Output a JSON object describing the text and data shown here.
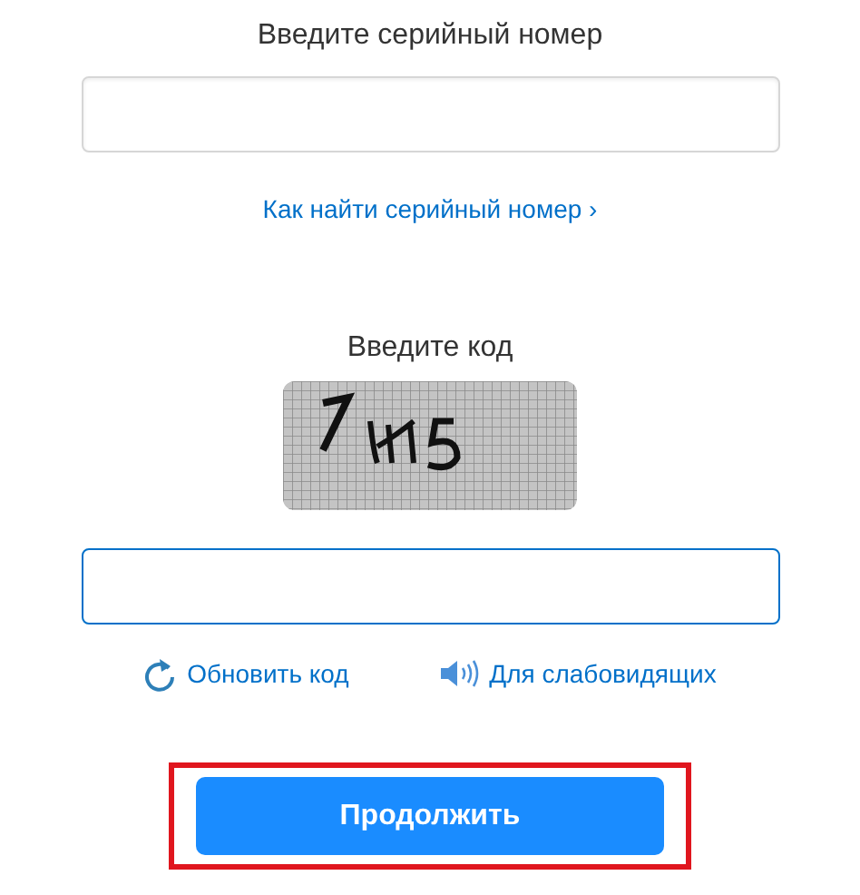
{
  "serial": {
    "label": "Введите серийный номер",
    "link": "Как найти серийный номер ›"
  },
  "captcha": {
    "label": "Введите код",
    "focused": true
  },
  "actions": [
    {
      "kind": "refresh",
      "label": "Обновить код"
    },
    {
      "kind": "audio",
      "label": "Для слабовидящих"
    }
  ],
  "submit": {
    "label": "Продолжить",
    "highlighted": true
  }
}
